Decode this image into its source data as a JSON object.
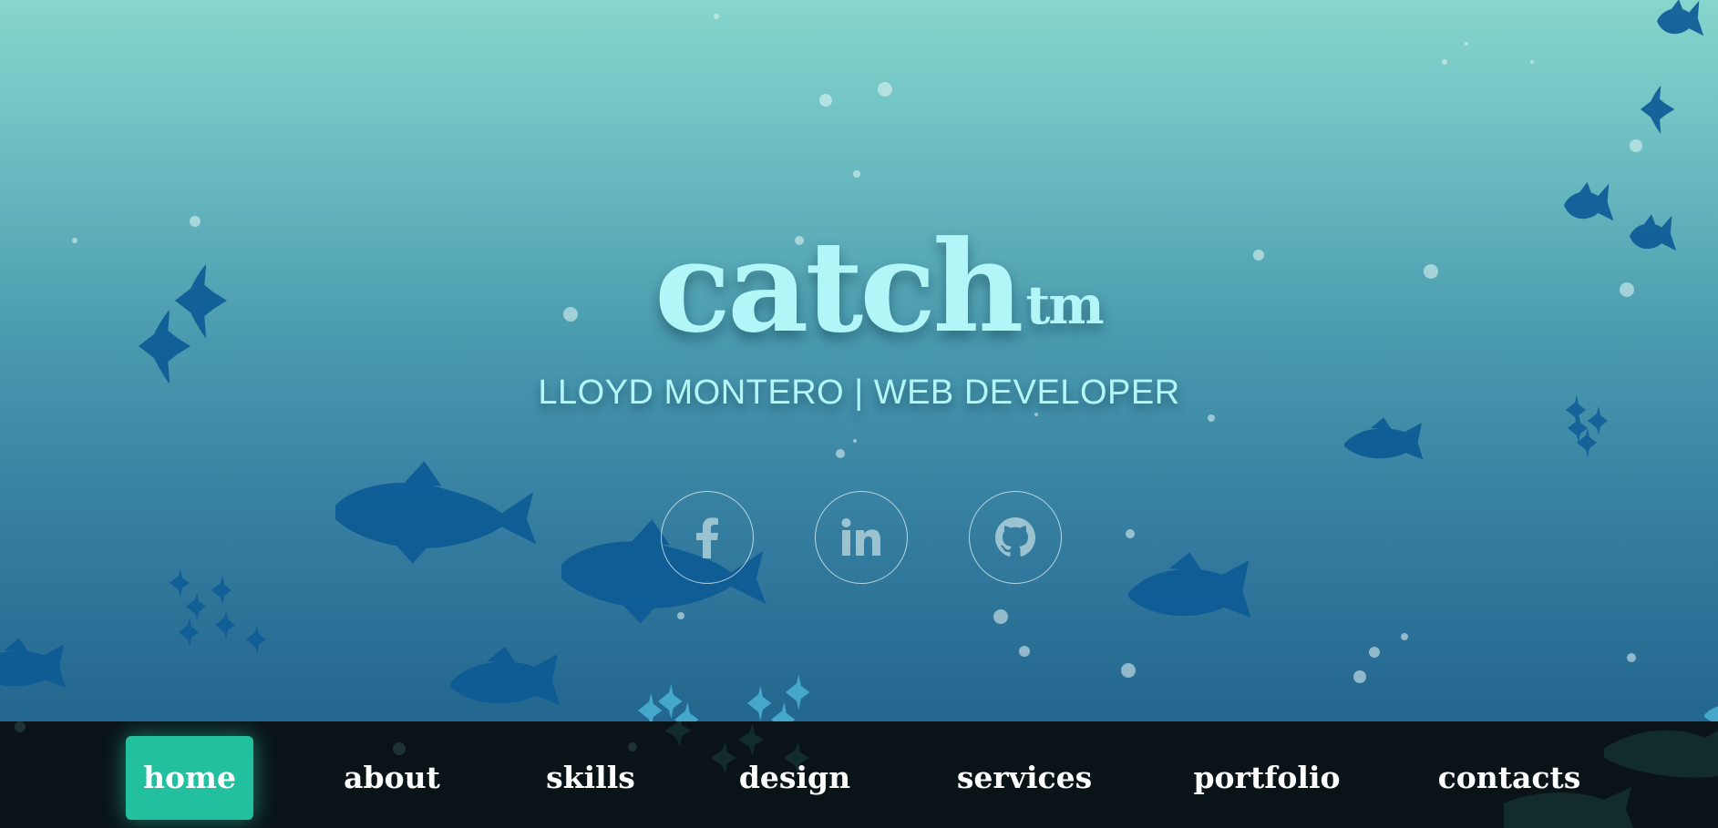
{
  "brand": {
    "logo": "catch",
    "logo_mark": "tm",
    "subtitle": "LLOYD MONTERO | WEB DEVELOPER"
  },
  "social": [
    {
      "name": "facebook",
      "icon": "facebook-icon"
    },
    {
      "name": "linkedin",
      "icon": "linkedin-icon"
    },
    {
      "name": "github",
      "icon": "github-icon"
    }
  ],
  "nav": {
    "items": [
      {
        "label": "home",
        "active": true
      },
      {
        "label": "about",
        "active": false
      },
      {
        "label": "skills",
        "active": false
      },
      {
        "label": "design",
        "active": false
      },
      {
        "label": "services",
        "active": false
      },
      {
        "label": "portfolio",
        "active": false
      },
      {
        "label": "contacts",
        "active": false
      }
    ]
  },
  "colors": {
    "accent": "#23c0a0",
    "title": "#b3f6f8",
    "fish": "#0e5b96",
    "nav_bg": "#0a1418"
  }
}
